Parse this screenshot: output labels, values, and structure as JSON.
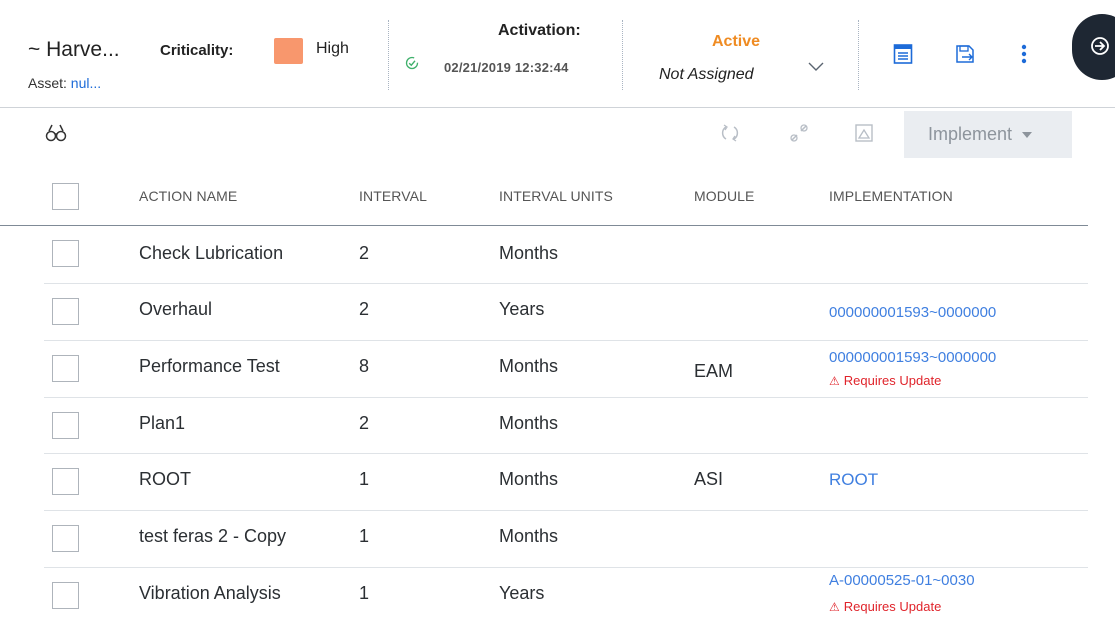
{
  "header": {
    "title": "~ Harve...",
    "asset_label": "Asset:",
    "asset_value": "nul...",
    "criticality_label": "Criticality:",
    "criticality_value": "High",
    "criticality_color": "#f8976d",
    "activation_label": "Activation:",
    "activation_date": "02/21/2019 12:32:44",
    "state": "Active",
    "state_color": "#ef8b22",
    "assigned": "Not Assigned",
    "icons": [
      "details-icon",
      "save-icon",
      "more-options-icon",
      "side-panel-toggle-icon"
    ],
    "accent_color": "#1d6bd8"
  },
  "toolbar": {
    "icons": [
      "search-icon",
      "refresh-icon",
      "unlink-icon",
      "image-icon"
    ],
    "implement_label": "Implement"
  },
  "table": {
    "columns": [
      "ACTION NAME",
      "INTERVAL",
      "INTERVAL UNITS",
      "MODULE",
      "IMPLEMENTATION"
    ],
    "rows": [
      {
        "name": "Check Lubrication",
        "interval": "2",
        "units": "Months",
        "module": "",
        "implementation": "",
        "warning": ""
      },
      {
        "name": "Overhaul",
        "interval": "2",
        "units": "Years",
        "module": "",
        "implementation": "000000001593~0000000",
        "warning": ""
      },
      {
        "name": "Performance Test",
        "interval": "8",
        "units": "Months",
        "module": "EAM",
        "implementation": "000000001593~0000000",
        "warning": "Requires Update"
      },
      {
        "name": "Plan1",
        "interval": "2",
        "units": "Months",
        "module": "",
        "implementation": "",
        "warning": ""
      },
      {
        "name": "ROOT",
        "interval": "1",
        "units": "Months",
        "module": "ASI",
        "implementation": "ROOT",
        "warning": ""
      },
      {
        "name": "test feras 2 - Copy",
        "interval": "1",
        "units": "Months",
        "module": "",
        "implementation": "",
        "warning": ""
      },
      {
        "name": "Vibration Analysis",
        "interval": "1",
        "units": "Years",
        "module": "",
        "implementation": "A-00000525-01~0030",
        "warning": "Requires Update"
      }
    ],
    "link_color": "#3f7fe0",
    "warning_color": "#e0242b"
  }
}
